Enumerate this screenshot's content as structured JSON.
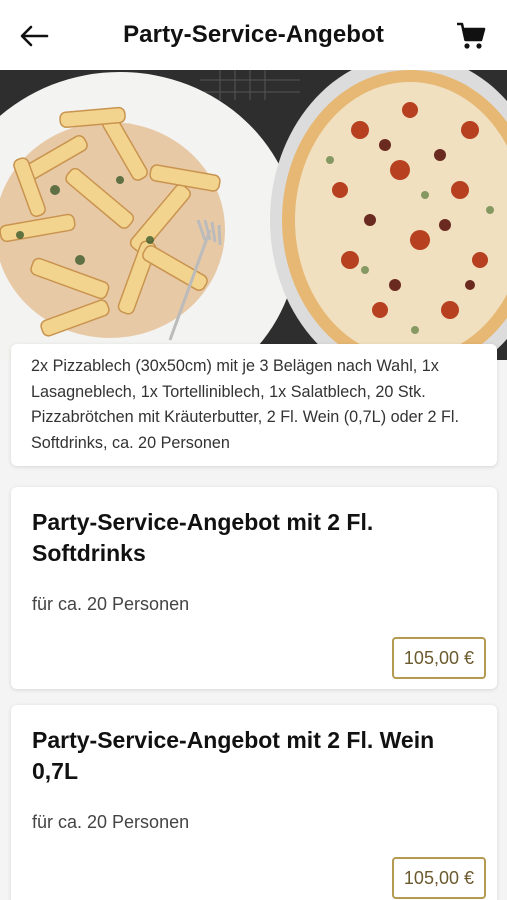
{
  "header": {
    "title": "Party-Service-Angebot",
    "back_icon": "arrow-left-icon",
    "cart_icon": "shopping-cart-icon"
  },
  "hero": {
    "image": "pasta-and-pizza-photo"
  },
  "description": "2x Pizzablech (30x50cm) mit je 3 Belägen nach Wahl, 1x Lasagneblech, 1x Tortelliniblech, 1x Salatblech, 20 Stk. Pizzabrötchen mit Kräuterbutter, 2 Fl. Wein (0,7L) oder 2 Fl. Softdrinks, ca. 20 Personen",
  "products": [
    {
      "name": "Party-Service-Angebot mit 2 Fl. Softdrinks",
      "subtitle": "für ca. 20 Personen",
      "price": "105,00 €"
    },
    {
      "name": "Party-Service-Angebot mit 2 Fl. Wein 0,7L",
      "subtitle": "für ca. 20 Personen",
      "price": "105,00 €"
    }
  ],
  "colors": {
    "accent": "#b59a52",
    "background": "#f4f4f4"
  }
}
